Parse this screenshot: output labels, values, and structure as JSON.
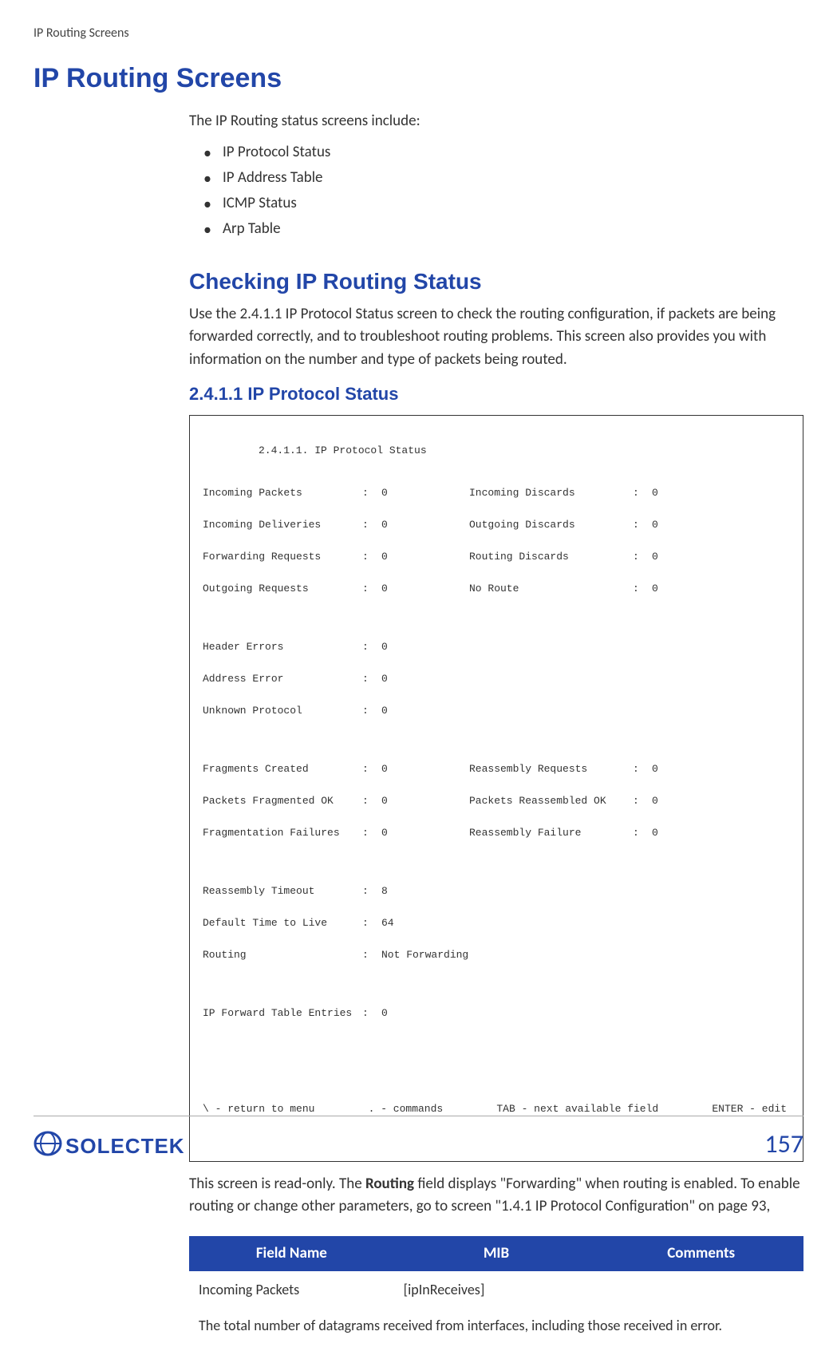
{
  "header": {
    "running_title": "IP Routing Screens"
  },
  "h1": "IP Routing Screens",
  "intro": "The IP Routing status screens include:",
  "bullets": [
    "IP Protocol Status",
    "IP Address Table",
    "ICMP Status",
    "Arp Table"
  ],
  "h2": "Checking IP Routing Status",
  "h2_para": "Use the 2.4.1.1 IP Protocol Status screen to check the routing configuration, if packets are being forwarded correctly, and to troubleshoot routing problems. This screen also provides you with information on the number and type of packets being routed.",
  "h3": "2.4.1.1 IP Protocol Status",
  "terminal": {
    "title": "2.4.1.1. IP Protocol Status",
    "rows_block1": [
      {
        "l": "Incoming Packets",
        "v": "0",
        "l2": "Incoming Discards",
        "v2": "0"
      },
      {
        "l": "Incoming Deliveries",
        "v": "0",
        "l2": "Outgoing Discards",
        "v2": "0"
      },
      {
        "l": "Forwarding Requests",
        "v": "0",
        "l2": "Routing Discards",
        "v2": "0"
      },
      {
        "l": "Outgoing Requests",
        "v": "0",
        "l2": "No Route",
        "v2": "0"
      }
    ],
    "rows_block2": [
      {
        "l": "Header Errors",
        "v": "0"
      },
      {
        "l": "Address Error",
        "v": "0"
      },
      {
        "l": "Unknown Protocol",
        "v": "0"
      }
    ],
    "rows_block3": [
      {
        "l": "Fragments Created",
        "v": "0",
        "l2": "Reassembly Requests",
        "v2": "0"
      },
      {
        "l": "Packets Fragmented OK",
        "v": "0",
        "l2": "Packets Reassembled OK",
        "v2": "0"
      },
      {
        "l": "Fragmentation Failures",
        "v": "0",
        "l2": "Reassembly Failure",
        "v2": "0"
      }
    ],
    "rows_block4": [
      {
        "l": "Reassembly Timeout",
        "v": "8"
      },
      {
        "l": "Default Time to Live",
        "v": "64"
      },
      {
        "l": "Routing",
        "v": "Not Forwarding"
      }
    ],
    "rows_block5": [
      {
        "l": "IP Forward Table Entries",
        "v": "0"
      }
    ],
    "footer": {
      "c1": "\\ - return to menu",
      "c2": ". - commands",
      "c3": "TAB - next available field",
      "c4": "ENTER - edit"
    }
  },
  "post_para_1": "This screen is read-only.  The ",
  "post_para_bold": "Routing",
  "post_para_2": " field displays \"Forwarding\" when routing is enabled.  To enable routing or change other parameters, go to screen \"1.4.1 IP Protocol Configuration\" on page 93,",
  "table": {
    "headers": {
      "c1": "Field Name",
      "c2": "MIB",
      "c3": "Comments"
    },
    "row": {
      "field": "Incoming Packets",
      "mib": "[ipInReceives]",
      "comments": ""
    },
    "desc": "The total number of datagrams received from interfaces, including those received in error."
  },
  "footer": {
    "page_number": "157",
    "logo_text": "SOLECTEK"
  }
}
